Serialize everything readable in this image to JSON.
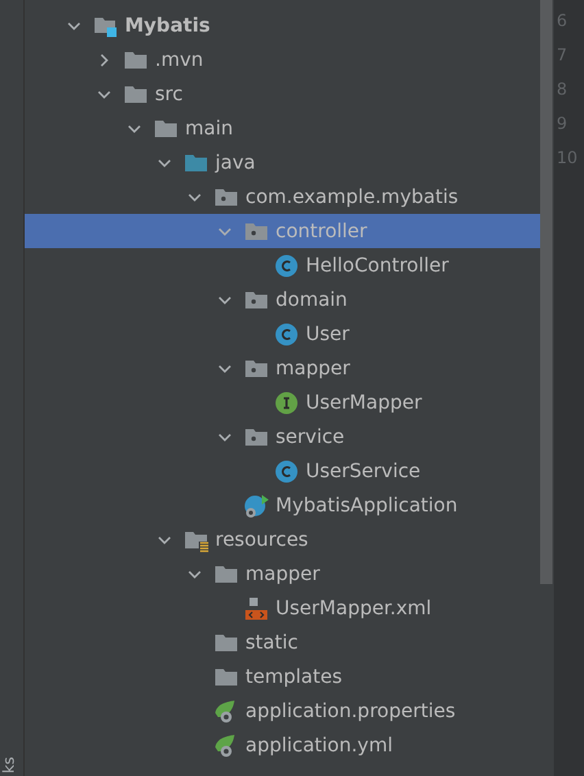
{
  "side_strip": {
    "label": "ks"
  },
  "tree": [
    {
      "label": "Mybatis",
      "kind": "module",
      "expanded": true,
      "selected": false,
      "children": [
        {
          "label": ".mvn",
          "kind": "folder",
          "expanded": false,
          "selected": false
        },
        {
          "label": "src",
          "kind": "folder",
          "expanded": true,
          "selected": false,
          "children": [
            {
              "label": "main",
              "kind": "folder",
              "expanded": true,
              "selected": false,
              "children": [
                {
                  "label": "java",
                  "kind": "source",
                  "expanded": true,
                  "selected": false,
                  "children": [
                    {
                      "label": "com.example.mybatis",
                      "kind": "package",
                      "expanded": true,
                      "selected": false,
                      "children": [
                        {
                          "label": "controller",
                          "kind": "package",
                          "expanded": true,
                          "selected": true,
                          "children": [
                            {
                              "label": "HelloController",
                              "kind": "class",
                              "selected": false
                            }
                          ]
                        },
                        {
                          "label": "domain",
                          "kind": "package",
                          "expanded": true,
                          "selected": false,
                          "children": [
                            {
                              "label": "User",
                              "kind": "class",
                              "selected": false
                            }
                          ]
                        },
                        {
                          "label": "mapper",
                          "kind": "package",
                          "expanded": true,
                          "selected": false,
                          "children": [
                            {
                              "label": "UserMapper",
                              "kind": "interface",
                              "selected": false
                            }
                          ]
                        },
                        {
                          "label": "service",
                          "kind": "package",
                          "expanded": true,
                          "selected": false,
                          "children": [
                            {
                              "label": "UserService",
                              "kind": "class",
                              "selected": false
                            }
                          ]
                        },
                        {
                          "label": "MybatisApplication",
                          "kind": "app",
                          "selected": false
                        }
                      ]
                    }
                  ]
                },
                {
                  "label": "resources",
                  "kind": "resources",
                  "expanded": true,
                  "selected": false,
                  "children": [
                    {
                      "label": "mapper",
                      "kind": "folder",
                      "expanded": true,
                      "selected": false,
                      "children": [
                        {
                          "label": "UserMapper.xml",
                          "kind": "xml",
                          "selected": false
                        }
                      ]
                    },
                    {
                      "label": "static",
                      "kind": "folder",
                      "selected": false
                    },
                    {
                      "label": "templates",
                      "kind": "folder",
                      "selected": false
                    },
                    {
                      "label": "application.properties",
                      "kind": "config",
                      "selected": false
                    },
                    {
                      "label": "application.yml",
                      "kind": "config",
                      "selected": false
                    }
                  ]
                }
              ]
            }
          ]
        }
      ]
    }
  ],
  "gutter": {
    "line_numbers": [
      "6",
      "7",
      "8",
      "9",
      "10"
    ]
  }
}
